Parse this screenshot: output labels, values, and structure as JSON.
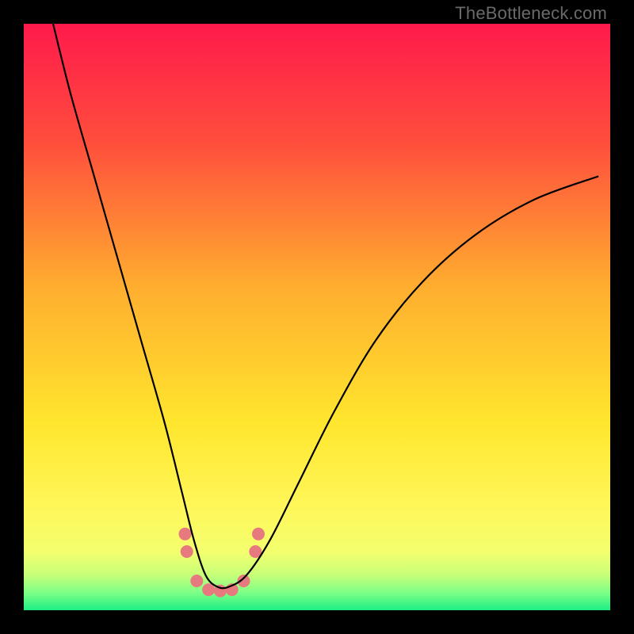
{
  "attribution": "TheBottleneck.com",
  "chart_data": {
    "type": "line",
    "title": "",
    "xlabel": "",
    "ylabel": "",
    "xlim": [
      0,
      100
    ],
    "ylim": [
      0,
      100
    ],
    "background_gradient_stops": [
      {
        "pct": 0,
        "color": "#ff1a4b"
      },
      {
        "pct": 20,
        "color": "#ff4d3d"
      },
      {
        "pct": 45,
        "color": "#ffae2f"
      },
      {
        "pct": 68,
        "color": "#ffe62e"
      },
      {
        "pct": 82,
        "color": "#fff658"
      },
      {
        "pct": 90,
        "color": "#f4ff6e"
      },
      {
        "pct": 94,
        "color": "#c7ff78"
      },
      {
        "pct": 97,
        "color": "#7dff87"
      },
      {
        "pct": 100,
        "color": "#1eee84"
      }
    ],
    "series": [
      {
        "name": "curve",
        "color": "#000000",
        "x": [
          5,
          8,
          12,
          16,
          20,
          24,
          27,
          29,
          31,
          33,
          35,
          38,
          42,
          47,
          53,
          60,
          68,
          77,
          87,
          98
        ],
        "y": [
          100,
          88,
          74,
          60,
          46,
          32,
          20,
          12,
          6,
          4,
          4,
          6,
          12,
          22,
          34,
          46,
          56,
          64,
          70,
          74
        ]
      }
    ],
    "markers": {
      "color": "#e77a7e",
      "radius_px": 8,
      "points": [
        {
          "x": 27.5,
          "y": 13
        },
        {
          "x": 27.8,
          "y": 10
        },
        {
          "x": 29.5,
          "y": 5
        },
        {
          "x": 31.5,
          "y": 3.5
        },
        {
          "x": 33.5,
          "y": 3.3
        },
        {
          "x": 35.5,
          "y": 3.5
        },
        {
          "x": 37.5,
          "y": 5
        },
        {
          "x": 39.5,
          "y": 10
        },
        {
          "x": 40.0,
          "y": 13
        }
      ]
    }
  }
}
